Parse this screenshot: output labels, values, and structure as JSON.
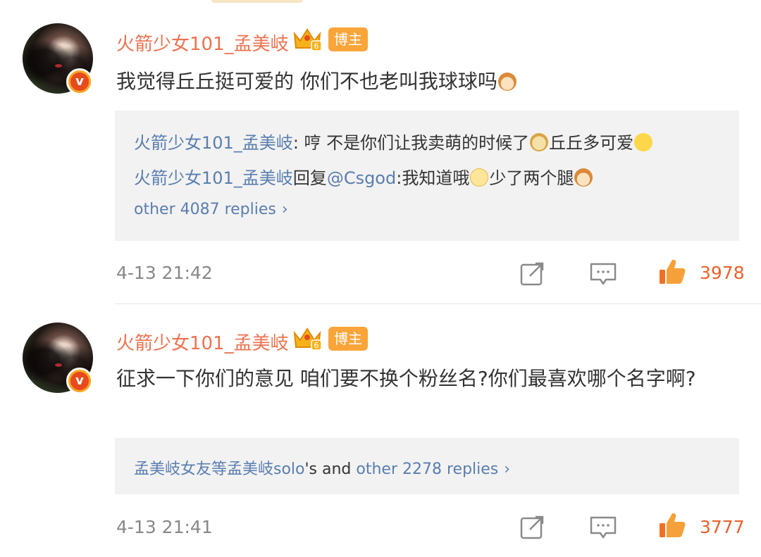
{
  "comments": [
    {
      "username": "火箭少女101_孟美岐",
      "badge": "博主",
      "text": "我觉得丘丘挺可爱的 你们不也老叫我球球吗",
      "replies": [
        {
          "user": "火箭少女101_孟美岐",
          "text_a": ": 哼 不是你们让我卖萌的时候了",
          "text_b": "丘丘多可爱"
        },
        {
          "user": "火箭少女101_孟美岐",
          "reply_word": "回复",
          "mention": "@Csgod",
          "text_a": ":我知道哦",
          "text_b": "少了两个腿"
        }
      ],
      "more_replies": "other 4087 replies",
      "timestamp": "4-13 21:42",
      "likes": "3978"
    },
    {
      "username": "火箭少女101_孟美岐",
      "badge": "博主",
      "text": "征求一下你们的意见 咱们要不换个粉丝名?你们最喜欢哪个名字啊?",
      "reply_summary": {
        "user": "孟美岐女友等孟美岐solo",
        "suffix": "'s and ",
        "more": "other 2278 replies"
      },
      "timestamp": "4-13 21:41",
      "likes": "3777"
    }
  ],
  "icons": {
    "crown": "crown-level-6-icon",
    "verified": "verified-v-icon",
    "repost": "repost-icon",
    "comment": "comment-icon",
    "like": "thumbs-up-icon",
    "chevron": "chevron-right-icon"
  },
  "colors": {
    "username": "#eb7350",
    "link": "#5a7eb0",
    "like": "#e8622c",
    "badge_bg": "#f9a53a"
  }
}
